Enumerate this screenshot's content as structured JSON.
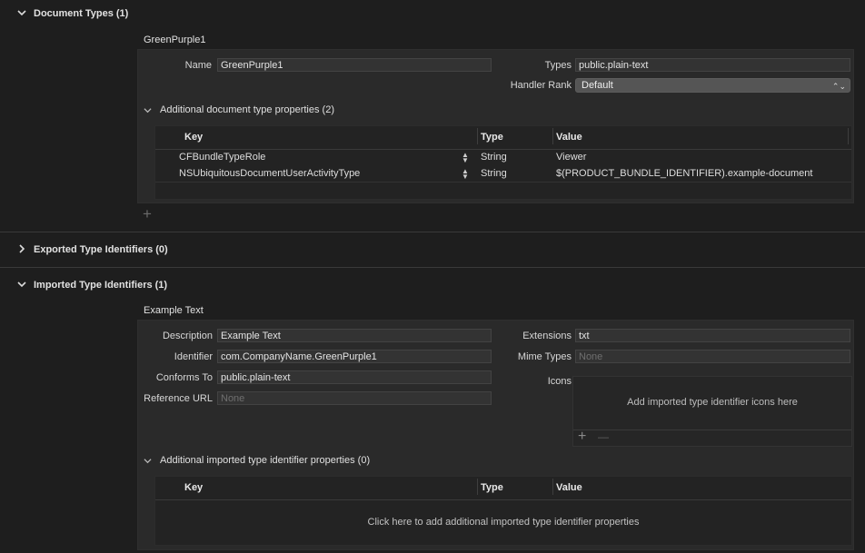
{
  "document_types": {
    "header": "Document Types (1)",
    "item_title": "GreenPurple1",
    "name_label": "Name",
    "name_value": "GreenPurple1",
    "types_label": "Types",
    "types_value": "public.plain-text",
    "handler_rank_label": "Handler Rank",
    "handler_rank_value": "Default",
    "additional_header": "Additional document type properties (2)",
    "table": {
      "columns": [
        "Key",
        "Type",
        "Value"
      ],
      "rows": [
        {
          "key": "CFBundleTypeRole",
          "type": "String",
          "value": "Viewer"
        },
        {
          "key": "NSUbiquitousDocumentUserActivityType",
          "type": "String",
          "value": "$(PRODUCT_BUNDLE_IDENTIFIER).example-document"
        }
      ]
    },
    "add_glyph": "+"
  },
  "exported_types": {
    "header": "Exported Type Identifiers (0)"
  },
  "imported_types": {
    "header": "Imported Type Identifiers (1)",
    "item_title": "Example Text",
    "description_label": "Description",
    "description_value": "Example Text",
    "identifier_label": "Identifier",
    "identifier_value": "com.CompanyName.GreenPurple1",
    "conforms_label": "Conforms To",
    "conforms_value": "public.plain-text",
    "reference_url_label": "Reference URL",
    "reference_url_placeholder": "None",
    "extensions_label": "Extensions",
    "extensions_value": "txt",
    "mime_label": "Mime Types",
    "mime_placeholder": "None",
    "icons_label": "Icons",
    "icons_placeholder": "Add imported type identifier icons here",
    "icons_add_glyph": "+",
    "icons_remove_glyph": "—",
    "additional_header": "Additional imported type identifier properties (0)",
    "table": {
      "columns": [
        "Key",
        "Type",
        "Value"
      ],
      "empty_message": "Click here to add additional imported type identifier properties"
    }
  }
}
